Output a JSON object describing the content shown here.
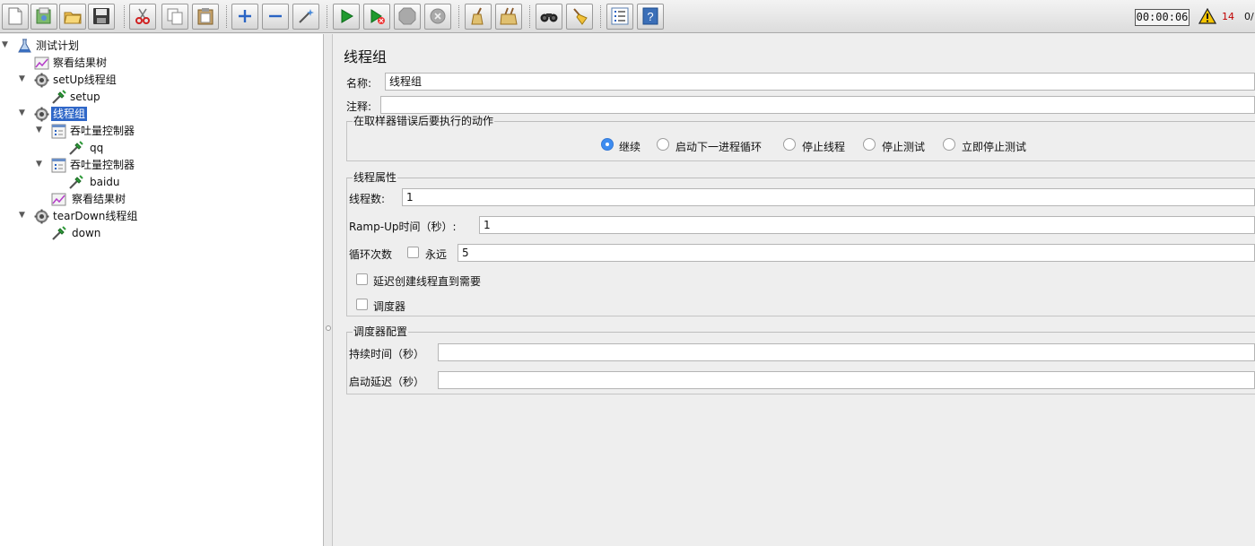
{
  "toolbar": {
    "buttons": [
      {
        "name": "new-file-icon",
        "tip": ""
      },
      {
        "name": "templates-icon",
        "tip": ""
      },
      {
        "name": "open-folder-icon",
        "tip": ""
      },
      {
        "name": "save-disk-icon",
        "tip": ""
      },
      {
        "name": "cut-scissors-icon",
        "tip": ""
      },
      {
        "name": "copy-icon",
        "tip": ""
      },
      {
        "name": "paste-clipboard-icon",
        "tip": ""
      },
      {
        "name": "expand-plus-icon",
        "tip": ""
      },
      {
        "name": "collapse-minus-icon",
        "tip": ""
      },
      {
        "name": "toggle-wand-icon",
        "tip": ""
      },
      {
        "name": "start-play-icon",
        "tip": ""
      },
      {
        "name": "start-no-pause-icon",
        "tip": ""
      },
      {
        "name": "stop-icon",
        "tip": ""
      },
      {
        "name": "shutdown-icon",
        "tip": ""
      },
      {
        "name": "clear-broom-icon",
        "tip": ""
      },
      {
        "name": "clear-all-broom-icon",
        "tip": ""
      },
      {
        "name": "search-binoculars-icon",
        "tip": ""
      },
      {
        "name": "reset-search-broom-icon",
        "tip": ""
      },
      {
        "name": "function-helper-list-icon",
        "tip": ""
      },
      {
        "name": "help-icon",
        "tip": ""
      }
    ],
    "timer": "00:00:06",
    "warning_count": "14",
    "active_threads": "0/"
  },
  "tree": {
    "nodes": [
      {
        "label": "测试计划",
        "icon": "test-plan-flask-icon",
        "expanded": true
      },
      {
        "label": "察看结果树",
        "icon": "results-tree-graph-icon"
      },
      {
        "label": "setUp线程组",
        "icon": "thread-group-gear-icon",
        "expanded": true
      },
      {
        "label": "setup",
        "icon": "sampler-pipette-icon"
      },
      {
        "label": "线程组",
        "icon": "thread-group-gear-icon",
        "expanded": true,
        "selected": true
      },
      {
        "label": "吞吐量控制器",
        "icon": "controller-icon",
        "expanded": true
      },
      {
        "label": "qq",
        "icon": "sampler-pipette-icon"
      },
      {
        "label": "吞吐量控制器",
        "icon": "controller-icon",
        "expanded": true
      },
      {
        "label": "baidu",
        "icon": "sampler-pipette-icon"
      },
      {
        "label": "察看结果树",
        "icon": "results-tree-graph-icon"
      },
      {
        "label": "tearDown线程组",
        "icon": "thread-group-gear-icon",
        "expanded": true
      },
      {
        "label": "down",
        "icon": "sampler-pipette-icon"
      }
    ]
  },
  "panel": {
    "title": "线程组",
    "name_label": "名称:",
    "name_value": "线程组",
    "comment_label": "注释:",
    "comment_value": "",
    "error_group": {
      "legend": "在取样器错误后要执行的动作",
      "options": [
        "继续",
        "启动下一进程循环",
        "停止线程",
        "停止测试",
        "立即停止测试"
      ],
      "selected": "继续"
    },
    "props_group": {
      "legend": "线程属性",
      "threads_label": "线程数:",
      "threads_value": "1",
      "rampup_label": "Ramp-Up时间（秒）:",
      "rampup_value": "1",
      "loop_label": "循环次数",
      "forever_label": "永远",
      "forever_checked": false,
      "loop_value": "5",
      "delay_label": "延迟创建线程直到需要",
      "delay_checked": false,
      "scheduler_label": "调度器",
      "scheduler_checked": false
    },
    "scheduler_group": {
      "legend": "调度器配置",
      "duration_label": "持续时间（秒）",
      "duration_value": "",
      "startup_label": "启动延迟（秒）",
      "startup_value": ""
    }
  },
  "colors": {
    "selection": "#2f67c8",
    "radio_selected": "#3d8cf0",
    "warning": "#c00000"
  }
}
